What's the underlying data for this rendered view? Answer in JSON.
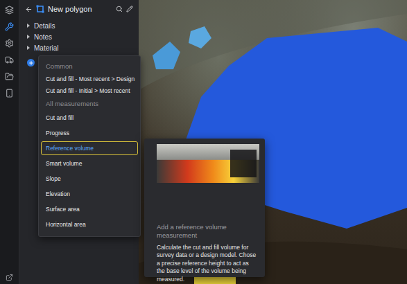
{
  "rail": {
    "items": [
      {
        "selected": false
      },
      {
        "selected": true
      },
      {
        "selected": false
      },
      {
        "selected": false
      },
      {
        "selected": false
      },
      {
        "selected": false
      }
    ]
  },
  "panel": {
    "title": "New polygon",
    "sections": [
      {
        "label": "Details",
        "expanded": false
      },
      {
        "label": "Notes",
        "expanded": false
      },
      {
        "label": "Material",
        "expanded": false
      }
    ]
  },
  "menu": {
    "groups": [
      {
        "heading": "Common",
        "items": [
          {
            "label": "Cut and fill - Most recent > Design",
            "selected": false
          },
          {
            "label": "Cut and fill - Initial > Most recent",
            "selected": false
          }
        ]
      },
      {
        "heading": "All measurements",
        "items": [
          {
            "label": "Cut and fill",
            "selected": false
          },
          {
            "label": "Progress",
            "selected": false
          },
          {
            "label": "Reference volume",
            "selected": true
          },
          {
            "label": "Smart volume",
            "selected": false
          },
          {
            "label": "Slope",
            "selected": false
          },
          {
            "label": "Elevation",
            "selected": false
          },
          {
            "label": "Surface area",
            "selected": false
          },
          {
            "label": "Horizontal area",
            "selected": false
          }
        ]
      }
    ]
  },
  "tooltip": {
    "title": "Add a reference volume measurement",
    "description": "Calculate the cut and fill volume for survey data or a design model. Chose a precise reference height to act as the base level of the volume being measured."
  }
}
